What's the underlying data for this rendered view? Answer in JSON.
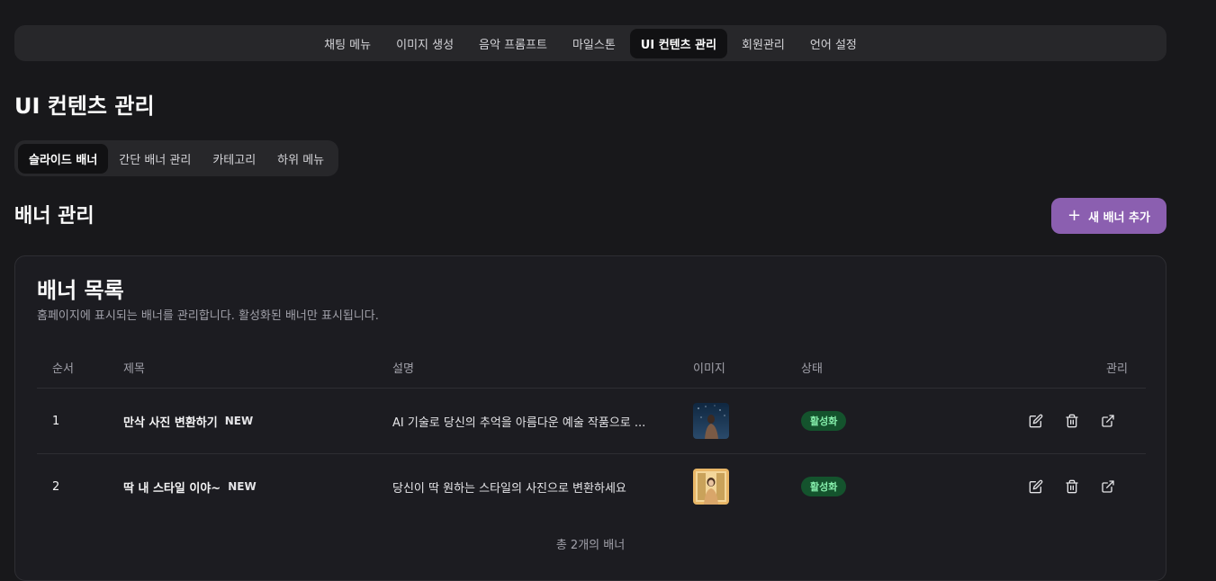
{
  "nav": {
    "items": [
      {
        "label": "채팅 메뉴"
      },
      {
        "label": "이미지 생성"
      },
      {
        "label": "음악 프롬프트"
      },
      {
        "label": "마일스톤"
      },
      {
        "label": "UI 컨텐츠 관리",
        "active": true
      },
      {
        "label": "회원관리"
      },
      {
        "label": "언어 설정"
      }
    ]
  },
  "page": {
    "title": "UI 컨텐츠 관리"
  },
  "subtabs": {
    "items": [
      {
        "label": "슬라이드 배너",
        "active": true
      },
      {
        "label": "간단 배너 관리"
      },
      {
        "label": "카테고리"
      },
      {
        "label": "하위 메뉴"
      }
    ]
  },
  "section": {
    "title": "배너 관리",
    "add_button": "새 배너 추가",
    "add_icon": "plus-icon",
    "accent_color": "#8b5fb0"
  },
  "card": {
    "title": "배너 목록",
    "description": "홈페이지에 표시되는 배너를 관리합니다. 활성화된 배너만 표시됩니다.",
    "total": "총 2개의 배너"
  },
  "table": {
    "headers": {
      "order": "순서",
      "title": "제목",
      "description": "설명",
      "image": "이미지",
      "status": "상태",
      "actions": "관리"
    },
    "rows": [
      {
        "order": "1",
        "title": "만삭 사진 변환하기",
        "badge": "NEW",
        "description": "AI 기술로 당신의 추억을 아름다운 예술 작품으로 ...",
        "status": "활성화",
        "status_color": "#14532d"
      },
      {
        "order": "2",
        "title": "딱 내 스타일 이야~",
        "badge": "NEW",
        "description": "당신이 딱 원하는 스타일의 사진으로 변환하세요",
        "status": "활성화",
        "status_color": "#14532d"
      }
    ],
    "action_icons": [
      "edit-icon",
      "trash-icon",
      "external-link-icon"
    ]
  }
}
